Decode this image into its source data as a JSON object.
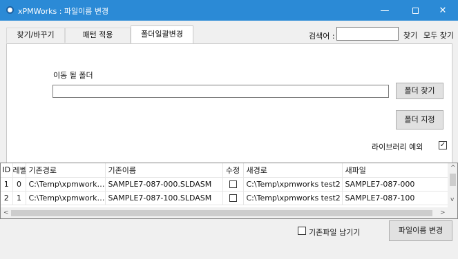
{
  "window": {
    "title": "xPMWorks : 파일이름 변경",
    "minimize_glyph": "—",
    "close_glyph": "✕"
  },
  "tabs": [
    {
      "label": "찾기/바꾸기"
    },
    {
      "label": "패턴 적용"
    },
    {
      "label": "폴더일괄변경",
      "selected": true
    }
  ],
  "search": {
    "label": "검색어 :",
    "value": "",
    "find_label": "찾기",
    "find_all_label": "모두 찾기"
  },
  "folder": {
    "label": "이동 될 폴더",
    "path_value": "",
    "find_button": "폴더 찾기",
    "set_button": "폴더 지정",
    "exclude_library_label": "라이브러리 예외",
    "exclude_library_checked": true,
    "check_glyph": "✓"
  },
  "grid": {
    "columns": [
      "ID",
      "레벨",
      "기존경로",
      "기존이름",
      "수정",
      "새경로",
      "새파일"
    ],
    "rows": [
      {
        "id": "1",
        "level": "0",
        "old_path": "C:\\Temp\\xpmworks...",
        "old_name": "SAMPLE7-087-000.SLDASM",
        "modified": false,
        "new_path": "C:\\Temp\\xpmworks test2",
        "new_file": "SAMPLE7-087-000"
      },
      {
        "id": "2",
        "level": "1",
        "old_path": "C:\\Temp\\xpmworks...",
        "old_name": "SAMPLE7-087-100.SLDASM",
        "modified": false,
        "new_path": "C:\\Temp\\xpmworks test2",
        "new_file": "SAMPLE7-087-100"
      }
    ]
  },
  "bottom": {
    "keep_original_label": "기존파일 남기기",
    "keep_original_checked": false,
    "rename_button": "파일이름 변경"
  },
  "icons": [
    "app-icon",
    "minimize-icon",
    "maximize-icon",
    "close-icon",
    "scroll-up-arrow-icon",
    "scroll-down-arrow-icon",
    "scroll-left-arrow-icon",
    "scroll-right-arrow-icon"
  ],
  "colors": {
    "titlebar": "#2b8ad6",
    "background": "#f0f0f0"
  }
}
